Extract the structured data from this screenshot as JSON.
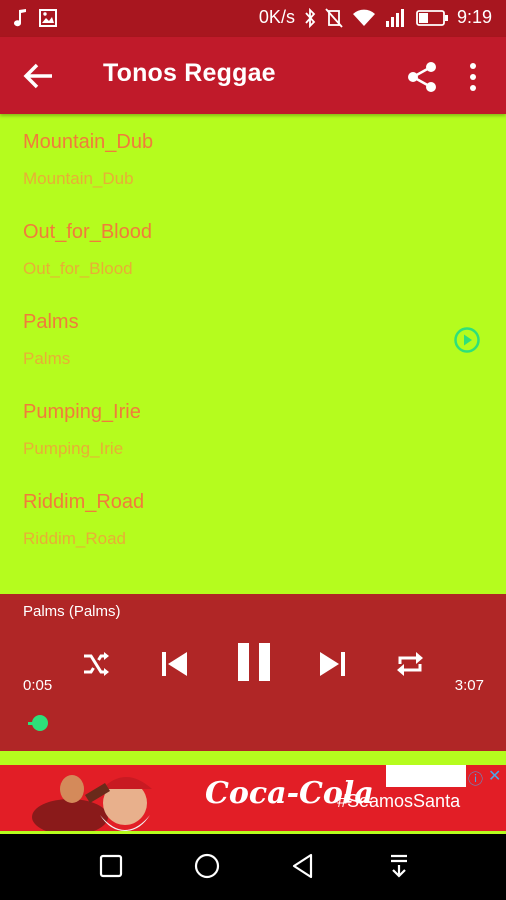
{
  "status_bar": {
    "speed": "0K/s",
    "time": "9:19"
  },
  "app_bar": {
    "title": "Tonos Reggae"
  },
  "colors": {
    "accent": "#c01a2a",
    "background": "#b5fc1e",
    "player": "#b02626",
    "seek": "#2ee07a",
    "item_title": "#f17b3b"
  },
  "tracks": [
    {
      "title": "Mountain_Dub",
      "subtitle": "Mountain_Dub"
    },
    {
      "title": "Out_for_Blood",
      "subtitle": "Out_for_Blood"
    },
    {
      "title": "Palms",
      "subtitle": "Palms"
    },
    {
      "title": "Pumping_Irie",
      "subtitle": "Pumping_Irie"
    },
    {
      "title": "Riddim_Road",
      "subtitle": "Riddim_Road"
    }
  ],
  "player": {
    "now_playing": "Palms (Palms)",
    "elapsed": "0:05",
    "duration": "3:07",
    "progress": 0.027,
    "icons": [
      "shuffle-icon",
      "previous-icon",
      "pause-icon",
      "next-icon",
      "repeat-icon"
    ]
  },
  "ad": {
    "brand": "Coca-Cola",
    "tagline": "#SeamosSanta",
    "info": "ⓘ",
    "close": "✕"
  },
  "nav_bar": {
    "icons": [
      "recents-icon",
      "home-icon",
      "back-icon",
      "notification-icon"
    ]
  }
}
